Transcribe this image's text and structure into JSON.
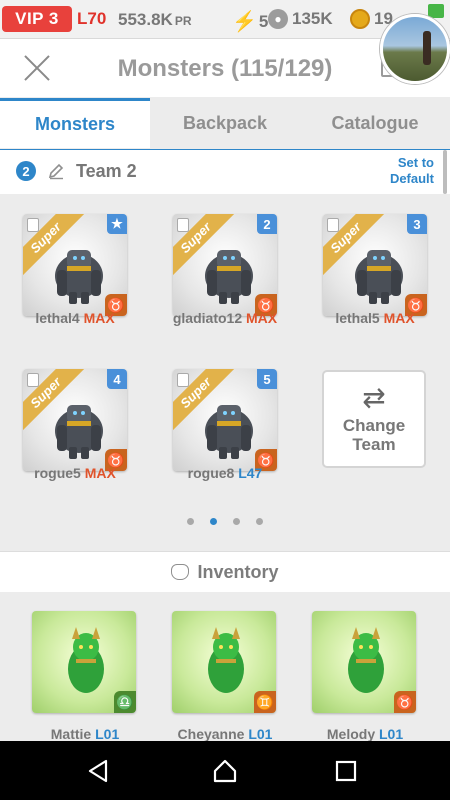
{
  "status": {
    "vip": "VIP 3",
    "level": "L70",
    "power": "553.8K",
    "power_unit": "PR",
    "energy": "5",
    "food": "135K",
    "gold": "19"
  },
  "header": {
    "title": "Monsters (115/129)"
  },
  "tabs": [
    {
      "label": "Monsters",
      "active": true
    },
    {
      "label": "Backpack",
      "active": false
    },
    {
      "label": "Catalogue",
      "active": false
    }
  ],
  "team": {
    "number": "2",
    "name": "Team 2",
    "set_default": "Set to Default"
  },
  "team_monsters": [
    {
      "tag": "Super",
      "corner": "★",
      "element": "♉",
      "name": "lethal4",
      "level": "MAX"
    },
    {
      "tag": "Super",
      "corner": "2",
      "element": "♉",
      "name": "gladiato12",
      "level": "MAX"
    },
    {
      "tag": "Super",
      "corner": "3",
      "element": "♉",
      "name": "lethal5",
      "level": "MAX"
    },
    {
      "tag": "Super",
      "corner": "4",
      "element": "♉",
      "name": "rogue5",
      "level": "MAX"
    },
    {
      "tag": "Super",
      "corner": "5",
      "element": "♉",
      "name": "rogue8",
      "level": "L47"
    }
  ],
  "change_team": {
    "label": "Change Team"
  },
  "pager": {
    "pages": 4,
    "active": 2
  },
  "inventory": {
    "title": "Inventory",
    "items": [
      {
        "element": "♎",
        "name": "Mattie",
        "level": "L01"
      },
      {
        "element": "♊",
        "name": "Cheyanne",
        "level": "L01"
      },
      {
        "element": "♉",
        "name": "Melody",
        "level": "L01"
      }
    ]
  },
  "colors": {
    "accent": "#2e86c9",
    "vip": "#e8413c",
    "max": "#e0532b",
    "super_tag": "#e2b24a"
  }
}
